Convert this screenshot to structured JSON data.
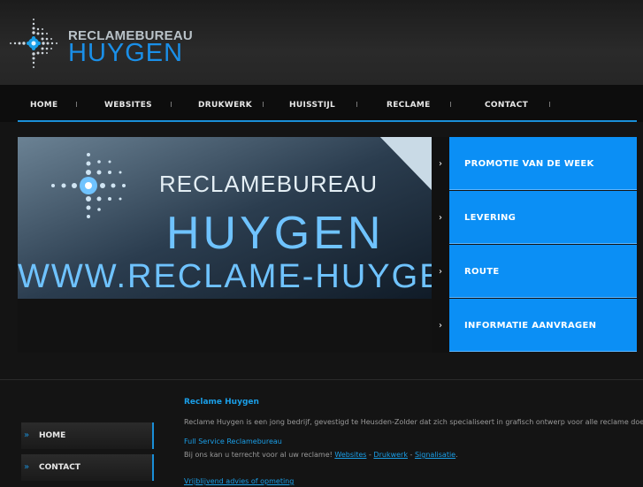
{
  "logo": {
    "line1": "RECLAMEBUREAU",
    "line2": "HUYGEN"
  },
  "nav": {
    "items": [
      "HOME",
      "WEBSITES",
      "DRUKWERK",
      "HUISSTIJL",
      "RECLAME",
      "CONTACT"
    ]
  },
  "hero": {
    "line1": "RECLAMEBUREAU",
    "line2": "HUYGEN",
    "line3": "WWW.RECLAME-HUYGEN.N"
  },
  "side_menu": {
    "arrow": "›",
    "items": [
      "PROMOTIE VAN DE WEEK",
      "LEVERING",
      "ROUTE",
      "INFORMATIE AANVRAGEN"
    ]
  },
  "left_nav": {
    "arrow": "»",
    "items": [
      "HOME",
      "CONTACT"
    ]
  },
  "content": {
    "title": "Reclame Huygen",
    "intro": "Reclame Huygen is een jong bedrijf, gevestigd te Heusden-Zolder dat zich specialiseert in grafisch ontwerp voor alle reclame doeleinden.",
    "subtitle": "Full Service Reclamebureau",
    "services_prefix": "Bij ons kan u terrecht voor al uw reclame!",
    "links": [
      "Websites",
      "Drukwerk",
      "Signalisatie"
    ],
    "separator": "-",
    "period": ".",
    "cut_line": "Vrijblijvend advies of opmeting"
  },
  "colors": {
    "accent": "#0b8ff5",
    "nav_line": "#1a8fd8"
  }
}
